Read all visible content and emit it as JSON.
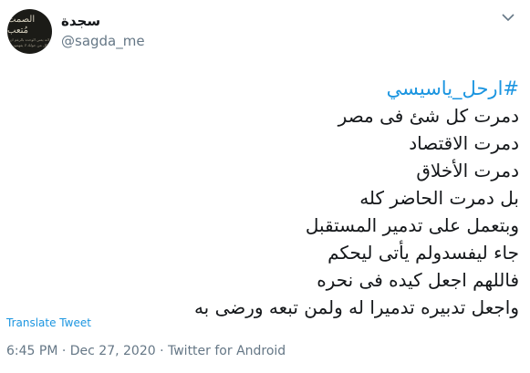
{
  "author": {
    "display_name": "سجدة",
    "handle": "@sagda_me",
    "avatar_text": "الصمت مُتعب",
    "avatar_subtext_1": "لانه يعني الوحده بالرغم ان",
    "avatar_subtext_2": "كل من حولك لا يفهمون"
  },
  "menu_icon": "chevron-down-icon",
  "tweet": {
    "hashtag": "#ارحل_ياسيسي",
    "lines": [
      "دمرت كل شئ فى مصر",
      "دمرت الاقتصاد",
      "دمرت الأخلاق",
      "بل دمرت الحاضر كله",
      "وبتعمل على تدمير المستقبل",
      "جاء ليفسدولم يأتى ليحكم",
      "فاللهم اجعل كيده فى نحره",
      "واجعل تدبيره تدميرا له ولمن تبعه ورضى به"
    ]
  },
  "translate_label": "Translate Tweet",
  "meta_line": "6:45 PM · Dec 27, 2020 · Twitter for Android",
  "colors": {
    "link": "#1b95e0",
    "text": "#14171a",
    "muted": "#657786",
    "avatar_bg": "#1b1b17"
  }
}
